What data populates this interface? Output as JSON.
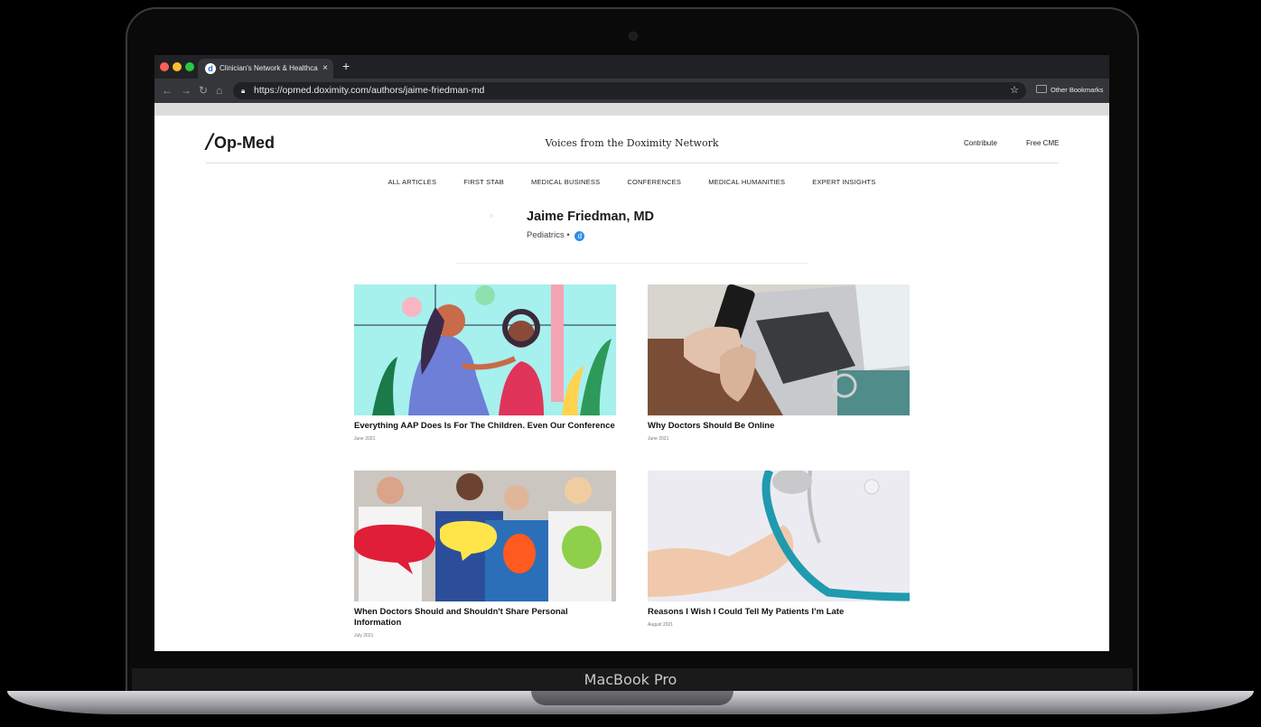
{
  "device": {
    "model_label": "MacBook Pro"
  },
  "browser": {
    "tab_title": "Clinician's Network & Healthca",
    "favicon": "d",
    "new_tab_label": "+",
    "close_label": "×",
    "url": "https://opmed.doximity.com/authors/jaime-friedman-md",
    "bookmarks_label": "Other Bookmarks"
  },
  "site": {
    "logo_text": "Op-Med",
    "tagline": "Voices from the Doximity Network",
    "header_links": [
      "Contribute",
      "Free CME"
    ],
    "nav": [
      "ALL ARTICLES",
      "FIRST STAB",
      "MEDICAL BUSINESS",
      "CONFERENCES",
      "MEDICAL HUMANITIES",
      "EXPERT INSIGHTS"
    ]
  },
  "author": {
    "name": "Jaime Friedman, MD",
    "specialty": "Pediatrics",
    "separator": "•",
    "badge": "d"
  },
  "articles": [
    {
      "title": "Everything AAP Does Is For The Children. Even Our Conference",
      "date": "June 2021"
    },
    {
      "title": "Why Doctors Should Be Online",
      "date": "June 2021"
    },
    {
      "title": "When Doctors Should and Shouldn't Share Personal Information",
      "date": "July 2021"
    },
    {
      "title": "Reasons I Wish I Could Tell My Patients I’m Late",
      "date": "August 2021"
    }
  ],
  "colors": {
    "accent_badge": "#2f8fe6",
    "chrome_dark": "#202124",
    "chrome_toolbar": "#35363a"
  }
}
